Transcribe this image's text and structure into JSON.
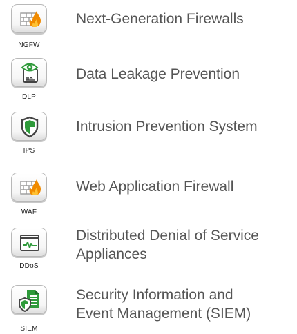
{
  "items": [
    {
      "abbr": "NGFW",
      "label": "Next-Generation Firewalls",
      "icon": "firewall-flame-icon"
    },
    {
      "abbr": "DLP",
      "label": "Data Leakage Prevention",
      "icon": "eye-document-icon"
    },
    {
      "abbr": "IPS",
      "label": "Intrusion Prevention System",
      "icon": "shield-icon"
    },
    {
      "abbr": "WAF",
      "label": "Web Application Firewall",
      "icon": "firewall-flame-icon"
    },
    {
      "abbr": "DDoS",
      "label_line1": "Distributed Denial of Service",
      "label_line2": "Appliances",
      "icon": "pulse-monitor-icon"
    },
    {
      "abbr": "SIEM",
      "label_line1": "Security Information and",
      "label_line2": "Event Management (SIEM)",
      "icon": "shield-document-icon"
    }
  ],
  "colors": {
    "accent_green": "#2e9a3a",
    "flame_orange": "#f08a00",
    "text_gray": "#555555"
  }
}
